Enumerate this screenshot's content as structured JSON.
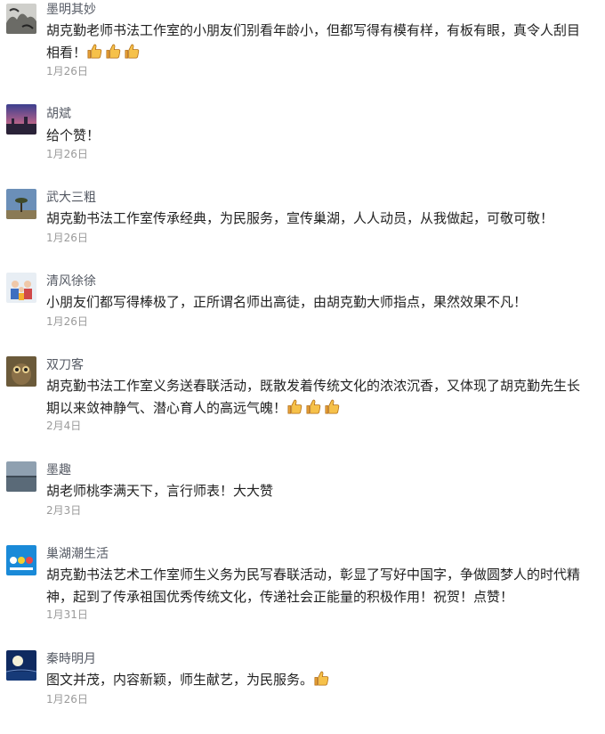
{
  "comments": [
    {
      "name": "墨明其妙",
      "text": "胡克勤老师书法工作室的小朋友们别看年龄小，但都写得有模有样，有板有眼，真令人刮目相看！",
      "thumbs": 3,
      "date": "1月26日",
      "avatar": "ink-painting-avatar"
    },
    {
      "name": "胡斌",
      "text": "给个赞！",
      "thumbs": 0,
      "date": "1月26日",
      "avatar": "sunset-city-avatar"
    },
    {
      "name": "武大三粗",
      "text": "胡克勤书法工作室传承经典，为民服务，宣传巢湖，人人动员，从我做起，可敬可敬！",
      "thumbs": 0,
      "date": "1月26日",
      "avatar": "lone-tree-avatar"
    },
    {
      "name": "清风徐徐",
      "text": "小朋友们都写得棒极了，正所谓名师出高徒，由胡克勤大师指点，果然效果不凡！",
      "thumbs": 0,
      "date": "1月26日",
      "avatar": "family-photo-avatar"
    },
    {
      "name": "双刀客",
      "text": "胡克勤书法工作室义务送春联活动，既散发着传统文化的浓浓沉香，又体现了胡克勤先生长期以来敛神静气、潜心育人的高远气魄！",
      "thumbs": 3,
      "date": "2月4日",
      "avatar": "owl-avatar"
    },
    {
      "name": "墨趣",
      "text": "胡老师桃李满天下，言行师表！大大赞",
      "thumbs": 0,
      "date": "2月3日",
      "avatar": "lake-horizon-avatar"
    },
    {
      "name": "巢湖潮生活",
      "text": "胡克勤书法艺术工作室师生义务为民写春联活动，彰显了写好中国字，争做圆梦人的时代精神，起到了传承祖国优秀传统文化，传递社会正能量的积极作用！祝贺！点赞！",
      "thumbs": 0,
      "date": "1月31日",
      "avatar": "brand-logo-avatar"
    },
    {
      "name": "秦時明月",
      "text": "图文并茂，内容新颖，师生献艺，为民服务。",
      "thumbs": 1,
      "date": "1月26日",
      "avatar": "moon-night-avatar"
    }
  ]
}
